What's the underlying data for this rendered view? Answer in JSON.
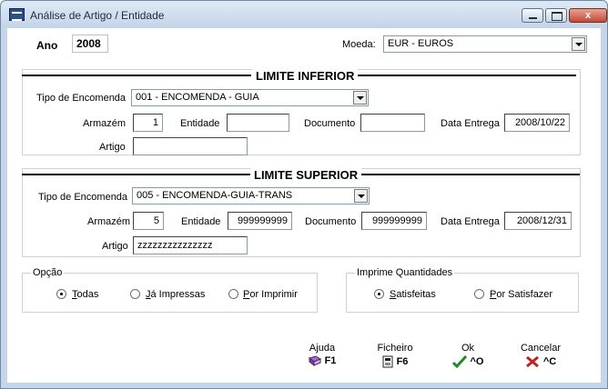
{
  "window": {
    "title": "Análise de Artigo / Entidade",
    "close_label": "x"
  },
  "header": {
    "ano_label": "Ano",
    "ano_value": "2008",
    "moeda_label": "Moeda:",
    "moeda_value": "EUR - EUROS"
  },
  "inferior": {
    "title": "LIMITE INFERIOR",
    "tipo_label": "Tipo de Encomenda",
    "tipo_value": "001 - ENCOMENDA - GUIA",
    "armazem_label": "Armazém",
    "armazem_value": "1",
    "entidade_label": "Entidade",
    "entidade_value": "",
    "documento_label": "Documento",
    "documento_value": "",
    "data_label": "Data Entrega",
    "data_value": "2008/10/22",
    "artigo_label": "Artigo",
    "artigo_value": ""
  },
  "superior": {
    "title": "LIMITE SUPERIOR",
    "tipo_label": "Tipo de Encomenda",
    "tipo_value": "005 - ENCOMENDA-GUIA-TRANS",
    "armazem_label": "Armazém",
    "armazem_value": "5",
    "entidade_label": "Entidade",
    "entidade_value": "999999999",
    "documento_label": "Documento",
    "documento_value": "999999999",
    "data_label": "Data Entrega",
    "data_value": "2008/12/31",
    "artigo_label": "Artigo",
    "artigo_value": "zzzzzzzzzzzzzzz"
  },
  "opcao": {
    "title": "Opção",
    "options": [
      "Todas",
      "Já Impressas",
      "Por Imprimir"
    ],
    "selected": "Todas"
  },
  "imprime": {
    "title": "Imprime Quantidades",
    "options": [
      "Satisfeitas",
      "Por Satisfazer"
    ],
    "selected": "Satisfeitas"
  },
  "toolbar": [
    {
      "caption": "Ajuda",
      "key": "F1",
      "icon": "book-icon"
    },
    {
      "caption": "Ficheiro",
      "key": "F6",
      "icon": "file-icon"
    },
    {
      "caption": "Ok",
      "key": "^O",
      "icon": "check-icon"
    },
    {
      "caption": "Cancelar",
      "key": "^C",
      "icon": "x-icon"
    }
  ]
}
